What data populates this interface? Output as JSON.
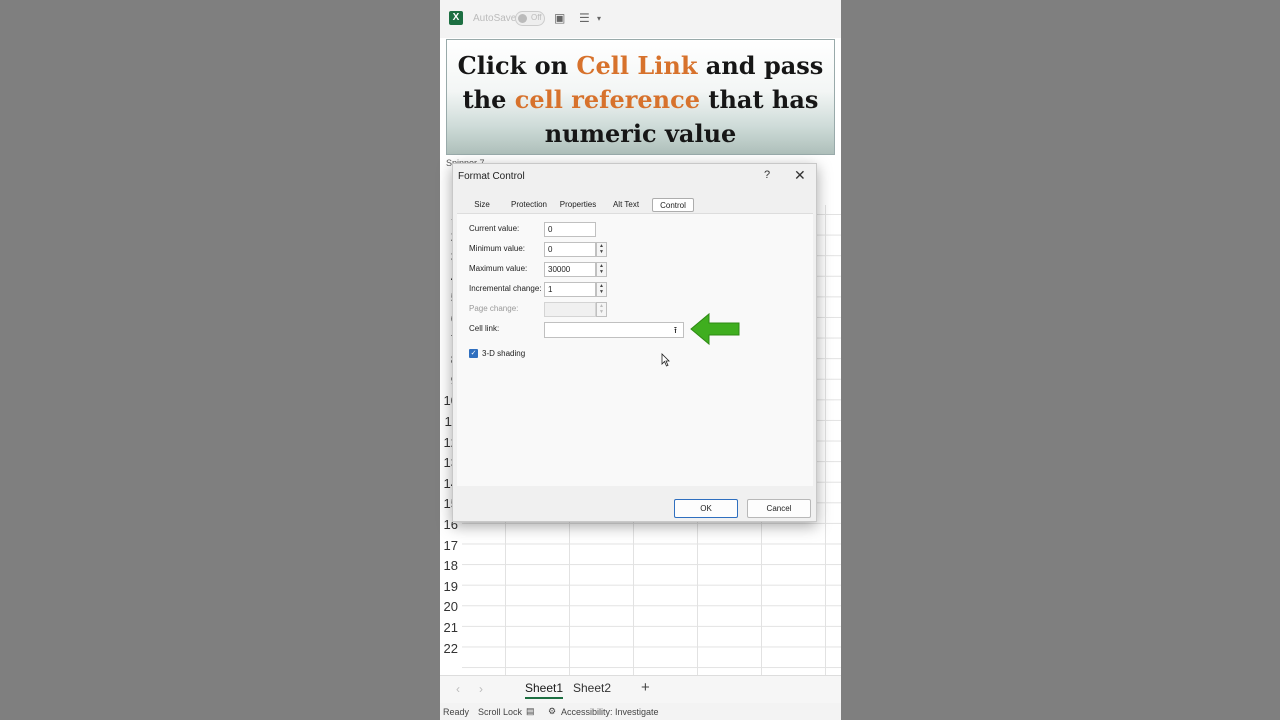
{
  "app": {
    "logo": "X",
    "autosave_label": "AutoSave",
    "autosave_state": "Off",
    "accent": "#1d6f42"
  },
  "banner": {
    "line1_a": "Click on ",
    "line1_hl": "Cell Link",
    "line1_b": " and pass",
    "line2_a": "the ",
    "line2_hl": "cell reference",
    "line2_b": " that has",
    "line3": "numeric value",
    "highlight_color": "#d7722c"
  },
  "sheet": {
    "namebox": "Spinner 7",
    "row_numbers": [
      "1",
      "2",
      "3",
      "4",
      "5",
      "6",
      "7",
      "8",
      "9",
      "10",
      "11",
      "12",
      "13",
      "14",
      "15",
      "16",
      "17",
      "18",
      "19",
      "20",
      "21",
      "22"
    ],
    "tabs": [
      {
        "label": "Sheet1",
        "active": true
      },
      {
        "label": "Sheet2",
        "active": false
      }
    ],
    "add_icon": "+",
    "prev_icon": "‹",
    "next_icon": "›"
  },
  "status": {
    "ready": "Ready",
    "scroll_lock": "Scroll Lock",
    "accessibility": "Accessibility: Investigate"
  },
  "dialog": {
    "title": "Format Control",
    "help": "?",
    "close": "✕",
    "tabs": [
      "Size",
      "Protection",
      "Properties",
      "Alt Text",
      "Control"
    ],
    "active_tab": "Control",
    "fields": {
      "current_label": "Current value:",
      "current_value": "0",
      "min_label": "Minimum value:",
      "min_value": "0",
      "max_label": "Maximum value:",
      "max_value": "30000",
      "inc_label": "Incremental change:",
      "inc_value": "1",
      "page_label": "Page change:",
      "page_value": "",
      "link_label": "Cell link:",
      "link_value": ""
    },
    "shading_label": "3-D shading",
    "shading_checked": true,
    "ok": "OK",
    "cancel": "Cancel"
  }
}
